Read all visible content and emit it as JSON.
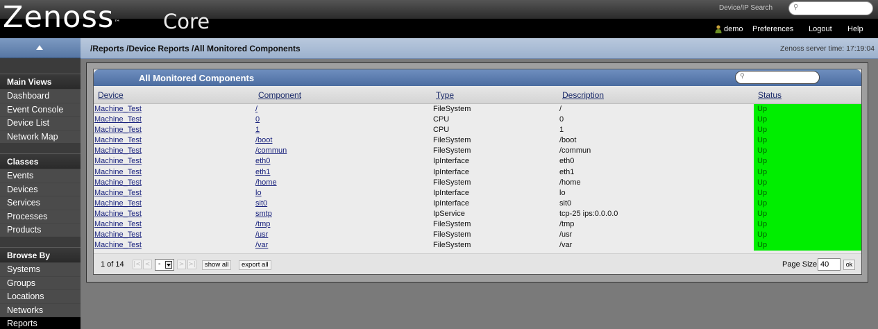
{
  "header": {
    "logo_text": "Zenoss",
    "logo_tm": "™",
    "logo_core": "Core",
    "search_label": "Device/IP Search",
    "user": "demo",
    "preferences": "Preferences",
    "logout": "Logout",
    "help": "Help"
  },
  "sidebar": {
    "sections": [
      {
        "title": "Main Views",
        "items": [
          "Dashboard",
          "Event Console",
          "Device List",
          "Network Map"
        ]
      },
      {
        "title": "Classes",
        "items": [
          "Events",
          "Devices",
          "Services",
          "Processes",
          "Products"
        ]
      },
      {
        "title": "Browse By",
        "items": [
          "Systems",
          "Groups",
          "Locations",
          "Networks",
          "Reports"
        ]
      }
    ]
  },
  "breadcrumb": "/Reports /Device Reports /All Monitored Components",
  "server_time": "Zenoss server time: 17:19:04",
  "panel": {
    "title": "All Monitored Components",
    "columns": [
      "Device",
      "Component",
      "Type",
      "Description",
      "Status"
    ],
    "rows": [
      [
        "Machine_Test",
        "/",
        "FileSystem",
        "/",
        "Up"
      ],
      [
        "Machine_Test",
        "0",
        "CPU",
        "0",
        "Up"
      ],
      [
        "Machine_Test",
        "1",
        "CPU",
        "1",
        "Up"
      ],
      [
        "Machine_Test",
        "/boot",
        "FileSystem",
        "/boot",
        "Up"
      ],
      [
        "Machine_Test",
        "/commun",
        "FileSystem",
        "/commun",
        "Up"
      ],
      [
        "Machine_Test",
        "eth0",
        "IpInterface",
        "eth0",
        "Up"
      ],
      [
        "Machine_Test",
        "eth1",
        "IpInterface",
        "eth1",
        "Up"
      ],
      [
        "Machine_Test",
        "/home",
        "FileSystem",
        "/home",
        "Up"
      ],
      [
        "Machine_Test",
        "lo",
        "IpInterface",
        "lo",
        "Up"
      ],
      [
        "Machine_Test",
        "sit0",
        "IpInterface",
        "sit0",
        "Up"
      ],
      [
        "Machine_Test",
        "smtp",
        "IpService",
        "tcp-25 ips:0.0.0.0",
        "Up"
      ],
      [
        "Machine_Test",
        "/tmp",
        "FileSystem",
        "/tmp",
        "Up"
      ],
      [
        "Machine_Test",
        "/usr",
        "FileSystem",
        "/usr",
        "Up"
      ],
      [
        "Machine_Test",
        "/var",
        "FileSystem",
        "/var",
        "Up"
      ]
    ],
    "status_color": "#00ee00"
  },
  "pager": {
    "page_label": "1 of 14",
    "first": "|<",
    "prev": "<",
    "page_select": "-",
    "next": ">",
    "last": ">|",
    "show_all": "show all",
    "export_all": "export all",
    "page_size_label": "Page Size",
    "page_size": "40",
    "ok": "ok"
  }
}
